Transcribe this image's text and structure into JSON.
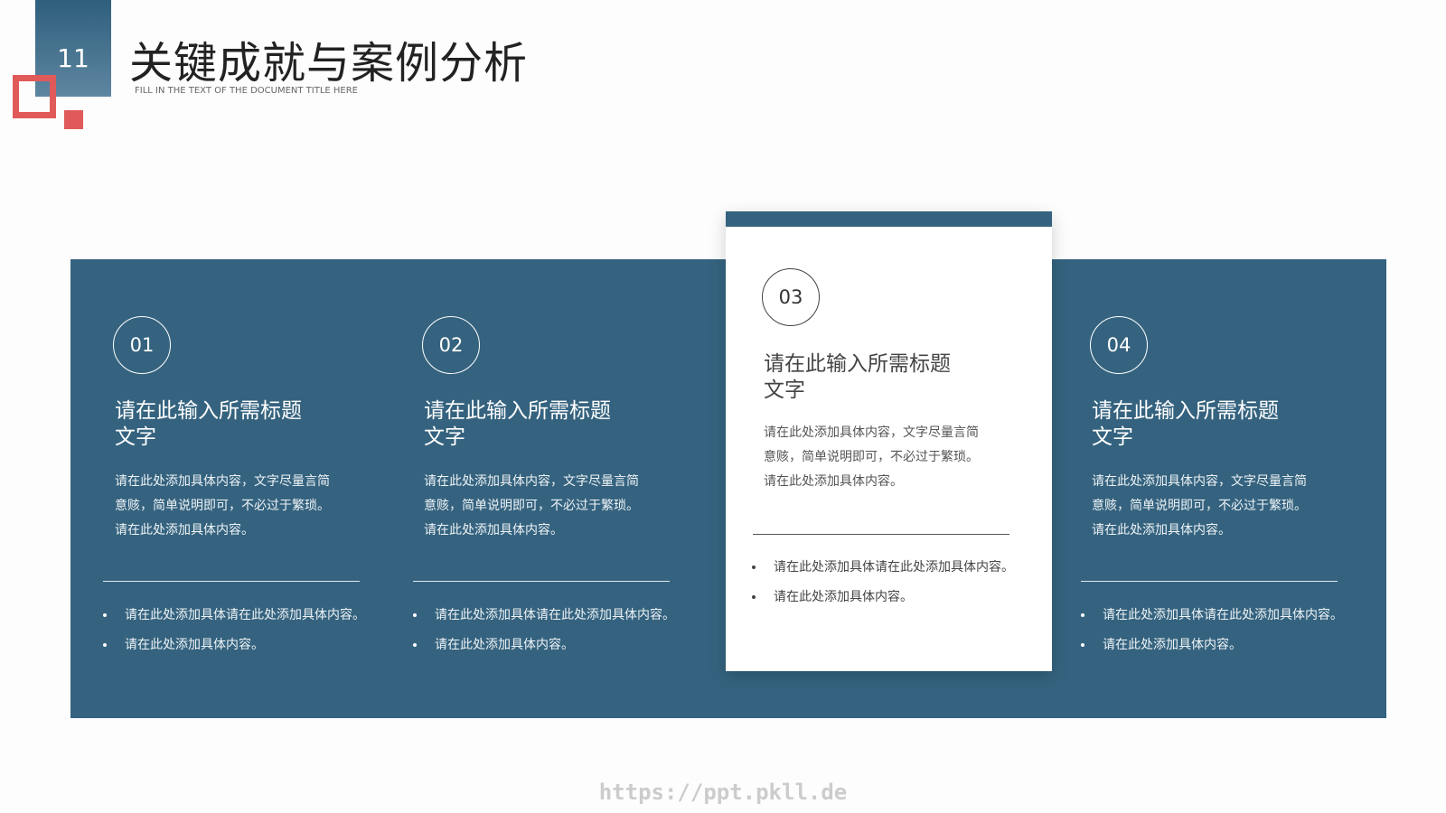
{
  "header": {
    "slide_number": "11",
    "title": "关键成就与案例分析",
    "subtitle": "FILL IN THE TEXT OF THE DOCUMENT TITLE HERE"
  },
  "cards": [
    {
      "number": "01",
      "title_line1": "请在此输入所需标题",
      "title_line2": "文字",
      "desc_line1": "请在此处添加具体内容，文字尽量言简",
      "desc_line2": "意赅，简单说明即可，不必过于繁琐。",
      "desc_line3": "请在此处添加具体内容。",
      "bullets": [
        "请在此处添加具体请在此处添加具体内容。",
        "请在此处添加具体内容。"
      ]
    },
    {
      "number": "02",
      "title_line1": "请在此输入所需标题",
      "title_line2": "文字",
      "desc_line1": "请在此处添加具体内容，文字尽量言简",
      "desc_line2": "意赅，简单说明即可，不必过于繁琐。",
      "desc_line3": "请在此处添加具体内容。",
      "bullets": [
        "请在此处添加具体请在此处添加具体内容。",
        "请在此处添加具体内容。"
      ]
    },
    {
      "number": "03",
      "title_line1": "请在此输入所需标题",
      "title_line2": "文字",
      "desc_line1": "请在此处添加具体内容，文字尽量言简",
      "desc_line2": "意赅，简单说明即可，不必过于繁琐。",
      "desc_line3": "请在此处添加具体内容。",
      "bullets": [
        "请在此处添加具体请在此处添加具体内容。",
        "请在此处添加具体内容。"
      ]
    },
    {
      "number": "04",
      "title_line1": "请在此输入所需标题",
      "title_line2": "文字",
      "desc_line1": "请在此处添加具体内容，文字尽量言简",
      "desc_line2": "意赅，简单说明即可，不必过于繁琐。",
      "desc_line3": "请在此处添加具体内容。",
      "bullets": [
        "请在此处添加具体请在此处添加具体内容。",
        "请在此处添加具体内容。"
      ]
    }
  ],
  "watermark": "https://ppt.pkll.de",
  "colors": {
    "primary_blue": "#35637f",
    "accent_red": "#e15a5a",
    "highlight_card_bg": "#ffffff"
  }
}
